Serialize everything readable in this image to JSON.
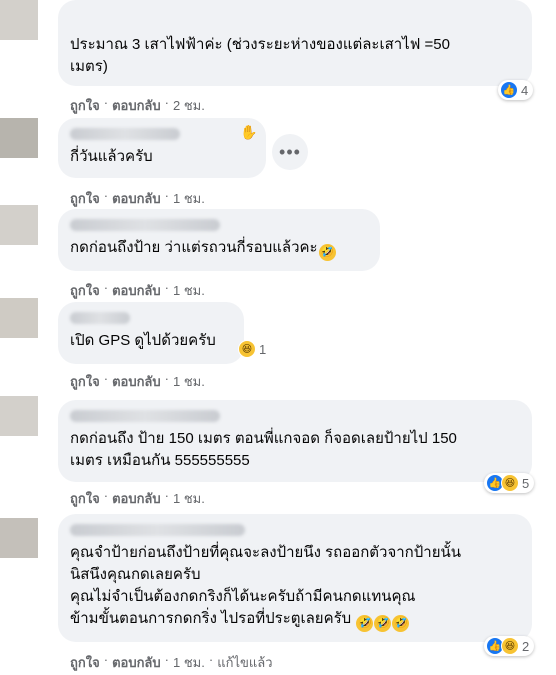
{
  "comments": [
    {
      "text": "ประมาณ 3 เสาไฟฟ้าค่ะ (ช่วงระยะห่างของแต่ละเสาไฟ =50 เมตร)",
      "line1": "ประมาณ 3 เสาไฟฟ้าค่ะ (ช่วงระยะห่างของแต่ละเสาไฟ =50",
      "line2": "เมตร)",
      "like": "ถูกใจ",
      "reply": "ตอบกลับ",
      "time": "2 ชม.",
      "reaction_count": "4",
      "reactions": [
        "like-icon"
      ]
    },
    {
      "text": "กี่วันแล้วครับ",
      "like": "ถูกใจ",
      "reply": "ตอบกลับ",
      "time": "1 ชม.",
      "more": "•••"
    },
    {
      "text": "กดก่อนถึงป้าย ว่าแต่รถวนกี่รอบแล้วคะ",
      "like": "ถูกใจ",
      "reply": "ตอบกลับ",
      "time": "1 ชม."
    },
    {
      "text": "เปิด GPS ดูไปด้วยครับ",
      "like": "ถูกใจ",
      "reply": "ตอบกลับ",
      "time": "1 ชม.",
      "reaction_count": "1",
      "reactions": [
        "haha-icon"
      ]
    },
    {
      "line1": "กดก่อนถึง ป้าย 150 เมตร ตอนพี่แกจอด ก็จอดเลยป้ายไป 150",
      "line2": "เมตร เหมือนกัน 555555555",
      "like": "ถูกใจ",
      "reply": "ตอบกลับ",
      "time": "1 ชม.",
      "reaction_count": "5",
      "reactions": [
        "like-icon",
        "haha-icon"
      ]
    },
    {
      "line1": "คุณจำป้ายก่อนถึงป้ายที่คุณจะลงป้ายนึง รถออกตัวจากป้ายนั้น",
      "line2": "นิสนึงคุณกดเลยครับ",
      "line3": "คุณไม่จำเป็นต้องกดกริงก็ได้นะครับถ้ามีคนกดแทนคุณ",
      "line4": "ข้ามขั้นตอนการกดกริ่ง ไปรอที่ประตูเลยครับ",
      "like": "ถูกใจ",
      "reply": "ตอบกลับ",
      "time": "1 ชม.",
      "edited": "แก้ไขแล้ว",
      "reaction_count": "2",
      "reactions": [
        "like-icon",
        "haha-icon"
      ]
    }
  ],
  "colors": {
    "bubble": "#f0f2f5",
    "meta": "#65676b",
    "like": "#1877f2",
    "haha": "#f7c333"
  }
}
